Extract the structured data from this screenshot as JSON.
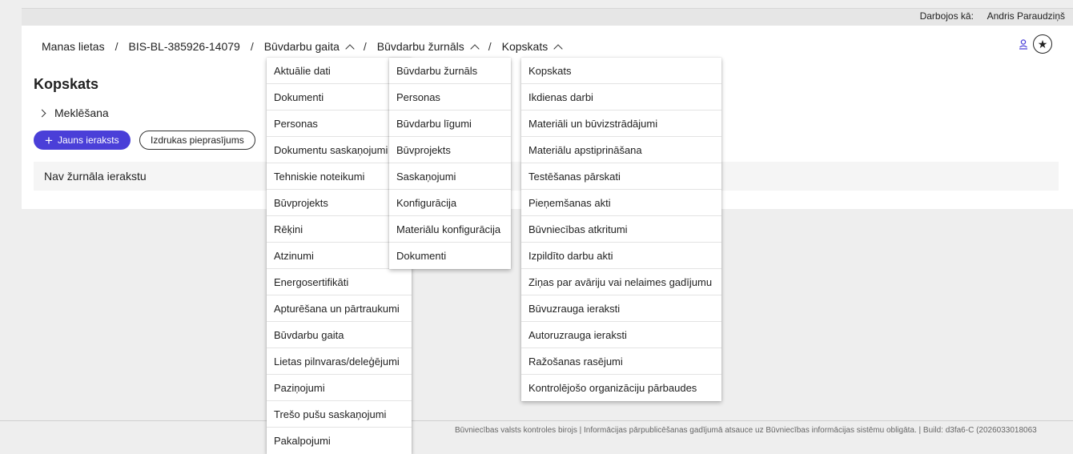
{
  "header": {
    "acting_label": "Darbojos kā:",
    "user_name": "Andris Paraudziņš"
  },
  "breadcrumb": {
    "items": [
      "Manas lietas",
      "BIS-BL-385926-14079",
      "Būvdarbu gaita",
      "Būvdarbu žurnāls",
      "Kopskats"
    ],
    "separator": "/"
  },
  "icons": {
    "profile": "person-icon",
    "favorite": "star-icon"
  },
  "page": {
    "title": "Kopskats",
    "search_label": "Meklēšana",
    "new_entry_button": "Jauns ieraksts",
    "print_request_button": "Izdrukas pieprasījums",
    "empty_message": "Nav žurnāla ierakstu"
  },
  "menus": {
    "gaita": [
      "Aktuālie dati",
      "Dokumenti",
      "Personas",
      "Dokumentu saskaņojumi",
      "Tehniskie noteikumi",
      "Būvprojekts",
      "Rēķini",
      "Atzinumi",
      "Energosertifikāti",
      "Apturēšana un pārtraukumi",
      "Būvdarbu gaita",
      "Lietas pilnvaras/deleģējumi",
      "Paziņojumi",
      "Trešo pušu saskaņojumi",
      "Pakalpojumi"
    ],
    "zurnals": [
      "Būvdarbu žurnāls",
      "Personas",
      "Būvdarbu līgumi",
      "Būvprojekts",
      "Saskaņojumi",
      "Konfigurācija",
      "Materiālu konfigurācija",
      "Dokumenti"
    ],
    "kopskats": [
      "Kopskats",
      "Ikdienas darbi",
      "Materiāli un būvizstrādājumi",
      "Materiālu apstiprināšana",
      "Testēšanas pārskati",
      "Pieņemšanas akti",
      "Būvniecības atkritumi",
      "Izpildīto darbu akti",
      "Ziņas par avāriju vai nelaimes gadījumu",
      "Būvuzrauga ieraksti",
      "Autoruzrauga ieraksti",
      "Ražošanas rasējumi",
      "Kontrolējošo organizāciju pārbaudes"
    ]
  },
  "footer": {
    "text": "Būvniecības valsts kontroles birojs | Informācijas pārpublicēšanas gadījumā atsauce uz Būvniecības informācijas sistēmu obligāta. | Build: d3fa6-C (2026033018063"
  },
  "colors": {
    "accent": "#4a3fd8",
    "background": "#eeeeee",
    "panel": "#ffffff"
  }
}
